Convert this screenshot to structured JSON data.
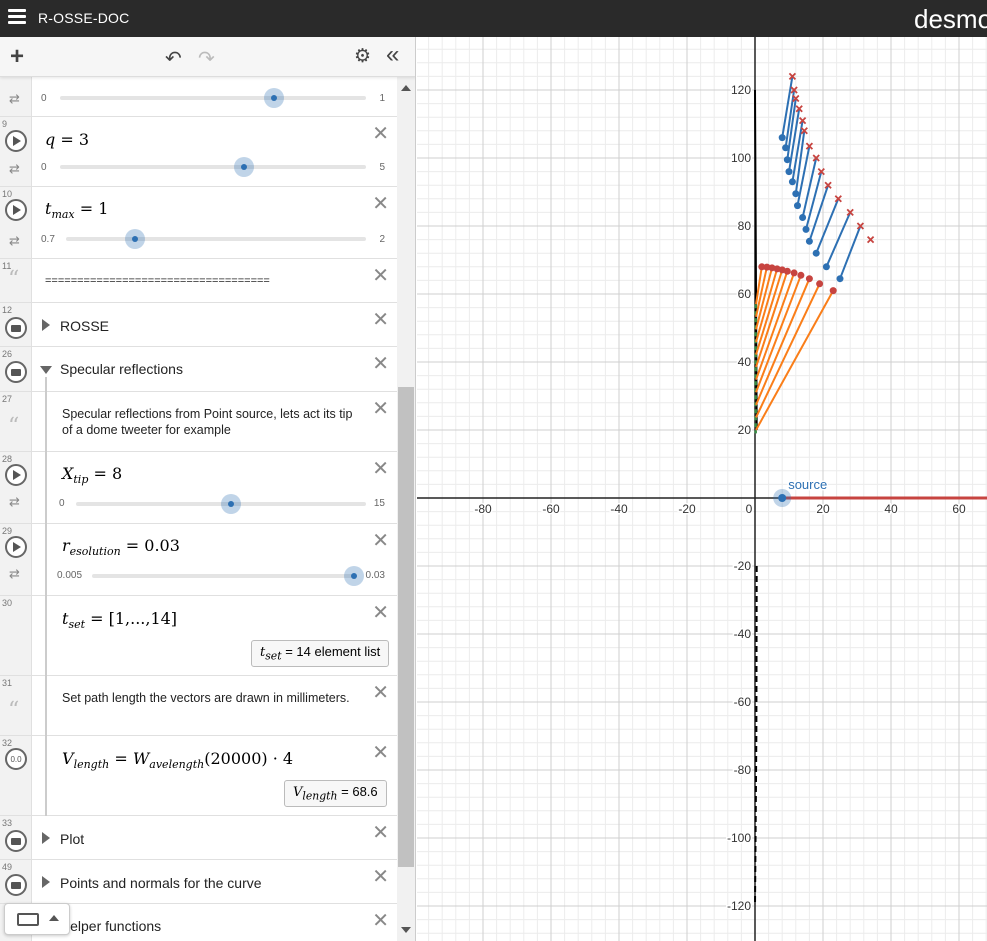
{
  "topbar": {
    "title": "R-OSSE-DOC",
    "brand": "desmos"
  },
  "toolbar": {
    "add": "+",
    "undo": "↶",
    "redo": "↷",
    "settings": "⚙",
    "collapse": "«"
  },
  "expressions": [
    {
      "id": "row-top",
      "slider": {
        "min": "0",
        "max": "1",
        "value": 0.7
      }
    },
    {
      "id": "9",
      "latex_name": "q",
      "latex_value": "3",
      "slider": {
        "min": "0",
        "max": "5",
        "value": 3
      }
    },
    {
      "id": "10",
      "latex_name": "t",
      "latex_sub": "max",
      "latex_value": "1",
      "slider": {
        "min": "0.7",
        "max": "2",
        "value": 1
      }
    },
    {
      "id": "11",
      "note": "==================================="
    },
    {
      "id": "12",
      "folder": "ROSSE"
    },
    {
      "id": "26",
      "folder": "Specular reflections"
    },
    {
      "id": "27",
      "note": "Specular reflections from Point source, lets act its tip of a dome tweeter for example"
    },
    {
      "id": "28",
      "latex_name": "X",
      "latex_sub": "tip",
      "latex_value": "8",
      "slider": {
        "min": "0",
        "max": "15",
        "value": 8
      }
    },
    {
      "id": "29",
      "latex_name": "r",
      "latex_sub": "esolution",
      "latex_value": "0.03",
      "slider": {
        "min": "0.005",
        "max": "0.03",
        "value": 0.03
      }
    },
    {
      "id": "30",
      "latex_name": "t",
      "latex_sub": "set",
      "latex_value": "[1,...,14]",
      "eval_name": "t",
      "eval_sub": "set",
      "eval_eq": "=",
      "eval_value": "14 element list"
    },
    {
      "id": "31",
      "note": "Set path length the vectors are drawn in millimeters."
    },
    {
      "id": "32",
      "latex_name": "V",
      "latex_sub": "length",
      "latex_eq": "=",
      "latex_rhs_name": "W",
      "latex_rhs_sub": "avelength",
      "latex_rhs_arg": "(20000)",
      "latex_rhs_tail": "· 4",
      "eval_name": "V",
      "eval_sub": "length",
      "eval_eq": "=",
      "eval_value": "68.6"
    },
    {
      "id": "33",
      "folder": "Plot"
    },
    {
      "id": "49",
      "folder": "Points and normals for the curve"
    },
    {
      "id": "",
      "folder": "Helper functions"
    }
  ],
  "keyboard": {
    "icon": "keyboard-icon"
  },
  "graph": {
    "x_ticks": [
      "-80",
      "-60",
      "-40",
      "-20",
      "0",
      "20",
      "40",
      "60"
    ],
    "y_ticks": [
      "120",
      "100",
      "80",
      "60",
      "40",
      "20",
      "-20",
      "-40",
      "-60",
      "-80",
      "-100",
      "-120"
    ],
    "source_label": "source",
    "colors": {
      "blue": "#2d70b3",
      "red": "#c74440",
      "orange": "#fa7e19",
      "green": "#388c46",
      "black": "#000000"
    }
  }
}
